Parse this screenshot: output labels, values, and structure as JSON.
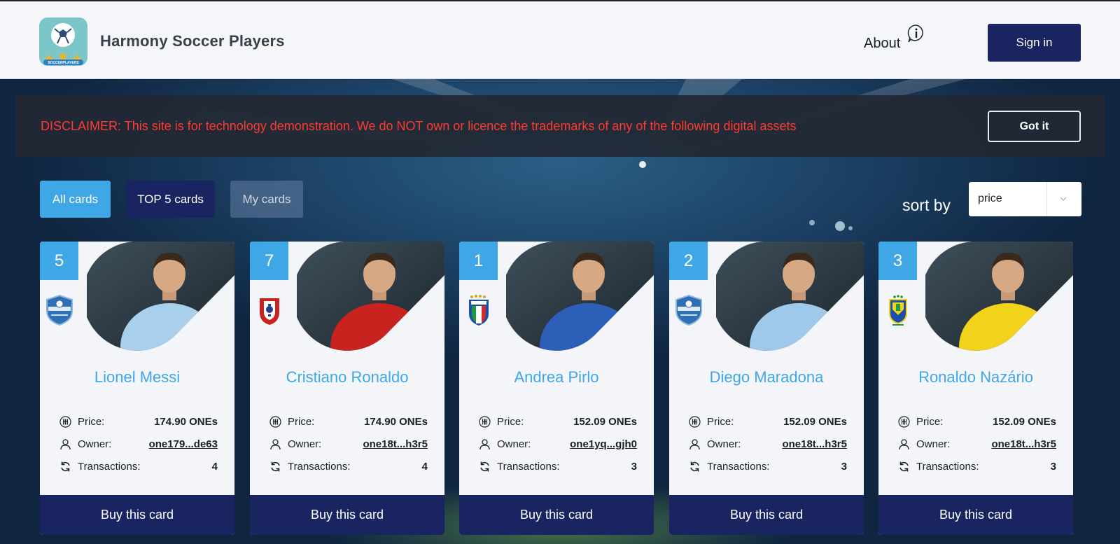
{
  "header": {
    "title": "Harmony Soccer Players",
    "logo_text": "SOCCERPLAYERS",
    "about_label": "About",
    "signin_label": "Sign in"
  },
  "disclaimer": {
    "text": "DISCLAIMER: This site is for technology demonstration. We do NOT own or licence the trademarks of any of the following digital assets",
    "button_label": "Got it"
  },
  "filters": {
    "tabs": [
      {
        "label": "All cards",
        "state": "active"
      },
      {
        "label": "TOP 5 cards",
        "state": "default"
      },
      {
        "label": "My cards",
        "state": "dimmed"
      }
    ],
    "sort_label": "sort by",
    "sort_value": "price"
  },
  "cards": [
    {
      "rank": "5",
      "name": "Lionel Messi",
      "price": "174.90 ONEs",
      "owner": "one179...de63",
      "transactions": "4",
      "crest": "argentina-crest-icon",
      "jersey": "#a8cfec"
    },
    {
      "rank": "7",
      "name": "Cristiano Ronaldo",
      "price": "174.90 ONEs",
      "owner": "one18t...h3r5",
      "transactions": "4",
      "crest": "portugal-crest-icon",
      "jersey": "#c8231f"
    },
    {
      "rank": "1",
      "name": "Andrea Pirlo",
      "price": "152.09 ONEs",
      "owner": "one1yq...gjh0",
      "transactions": "3",
      "crest": "italy-crest-icon",
      "jersey": "#2c5fb8"
    },
    {
      "rank": "2",
      "name": "Diego Maradona",
      "price": "152.09 ONEs",
      "owner": "one18t...h3r5",
      "transactions": "3",
      "crest": "argentina-crest-icon",
      "jersey": "#9fc9ea"
    },
    {
      "rank": "3",
      "name": "Ronaldo Nazário",
      "price": "152.09 ONEs",
      "owner": "one18t...h3r5",
      "transactions": "3",
      "crest": "brazil-crest-icon",
      "jersey": "#f2d21a"
    }
  ],
  "labels": {
    "price": "Price:",
    "owner": "Owner:",
    "transactions": "Transactions:",
    "buy": "Buy this card"
  },
  "colors": {
    "accent": "#3fa7e6",
    "navy": "#1a2460",
    "warning": "#ff3b2f"
  }
}
